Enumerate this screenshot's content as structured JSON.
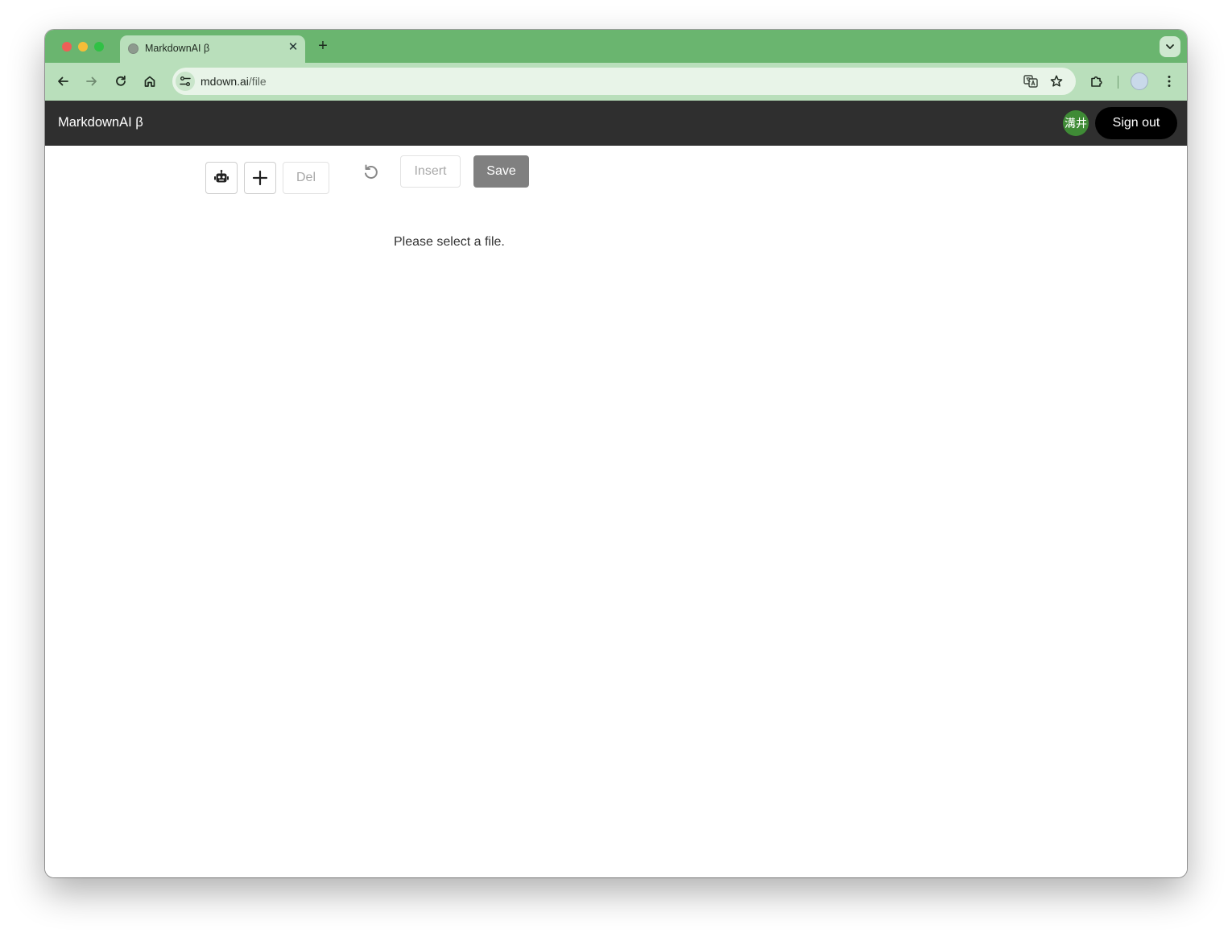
{
  "browser": {
    "tab": {
      "title": "MarkdownAI β",
      "close_glyph": "✕",
      "favicon": "globe-icon"
    },
    "new_tab_glyph": "+",
    "address": {
      "host": "mdown.ai",
      "path": "/file"
    },
    "colors": {
      "frame": "#6ab56f",
      "toolbar": "#b9dfbb",
      "omnibox": "#e8f4e8"
    }
  },
  "app": {
    "brand": "MarkdownAI β",
    "user": {
      "avatar_text": "溝井"
    },
    "sign_out_label": "Sign out",
    "toolbar": {
      "ai_icon": "robot-icon",
      "add_icon": "plus-icon",
      "del_label": "Del",
      "undo_icon": "undo-icon",
      "insert_label": "Insert",
      "save_label": "Save"
    },
    "empty_message": "Please select a file.",
    "colors": {
      "header_bg": "#2f2f2f",
      "avatar_bg": "#3f8b36",
      "save_bg": "#808080"
    }
  }
}
